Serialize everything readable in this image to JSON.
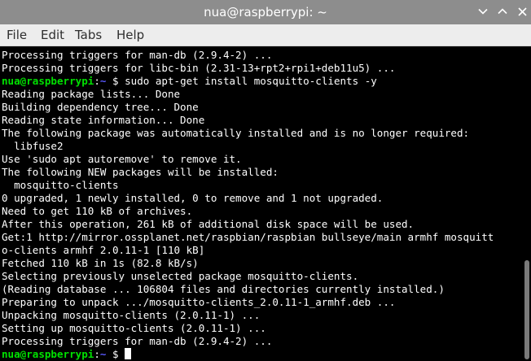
{
  "window": {
    "title": "nua@raspberrypi: ~"
  },
  "menu": {
    "file": "File",
    "edit": "Edit",
    "tabs": "Tabs",
    "help": "Help"
  },
  "terminal": {
    "prompt_user": "nua@raspberrypi",
    "prompt_sep": ":",
    "prompt_path": "~",
    "prompt_symbol": " $ ",
    "lines_before": [
      "Processing triggers for man-db (2.9.4-2) ...",
      "Processing triggers for libc-bin (2.31-13+rpt2+rpi1+deb11u5) ..."
    ],
    "command": "sudo apt-get install mosquitto-clients -y",
    "output": [
      "Reading package lists... Done",
      "Building dependency tree... Done",
      "Reading state information... Done",
      "The following package was automatically installed and is no longer required:",
      "  libfuse2",
      "Use 'sudo apt autoremove' to remove it.",
      "The following NEW packages will be installed:",
      "  mosquitto-clients",
      "0 upgraded, 1 newly installed, 0 to remove and 1 not upgraded.",
      "Need to get 110 kB of archives.",
      "After this operation, 261 kB of additional disk space will be used.",
      "Get:1 http://mirror.ossplanet.net/raspbian/raspbian bullseye/main armhf mosquitt",
      "o-clients armhf 2.0.11-1 [110 kB]",
      "Fetched 110 kB in 1s (82.8 kB/s)",
      "Selecting previously unselected package mosquitto-clients.",
      "(Reading database ... 106804 files and directories currently installed.)",
      "Preparing to unpack .../mosquitto-clients_2.0.11-1_armhf.deb ...",
      "Unpacking mosquitto-clients (2.0.11-1) ...",
      "Setting up mosquitto-clients (2.0.11-1) ...",
      "Processing triggers for man-db (2.9.4-2) ..."
    ]
  },
  "colors": {
    "titlebar": "#8d8d8d",
    "menubar": "#ededed",
    "terminal_bg": "#000000",
    "prompt_user": "#00e000",
    "prompt_path": "#5a5aff"
  },
  "icons": {
    "minimize": "chevron-down-icon",
    "maximize": "chevron-up-icon",
    "close": "close-icon"
  }
}
